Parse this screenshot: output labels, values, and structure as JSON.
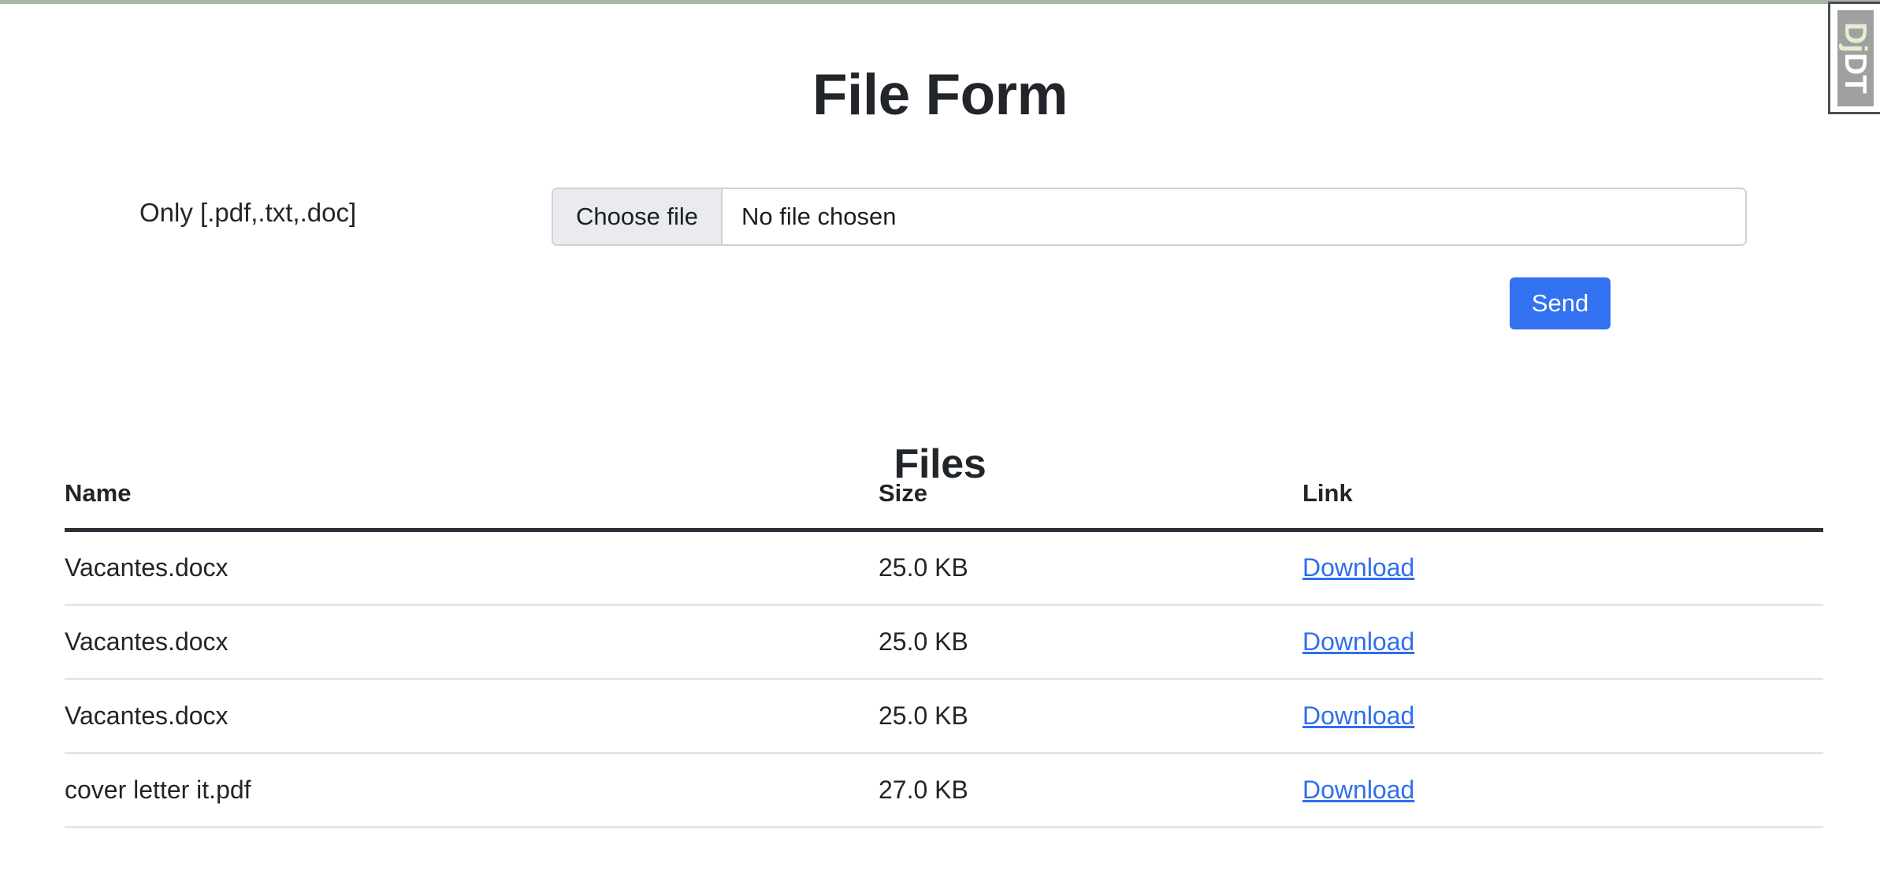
{
  "page": {
    "title": "File Form",
    "accent_top_border_color": "#a8b4a4"
  },
  "debug_toolbar": {
    "label_prefix": "Dj",
    "label_suffix": "DT",
    "prefix_color": "#e2f0d0",
    "suffix_color": "#ffffff",
    "background_color": "#a0a0a0"
  },
  "form": {
    "label": "Only [.pdf,.txt,.doc]",
    "file_input": {
      "button_label": "Choose file",
      "value": "No file chosen",
      "placeholder": "No file chosen"
    },
    "submit": {
      "label": "Send",
      "color": "#3272f0"
    }
  },
  "files_section": {
    "heading": "Files",
    "columns": [
      "Name",
      "Size",
      "Link"
    ],
    "link_label": "Download",
    "link_color": "#2f6fed",
    "rows": [
      {
        "name": "Vacantes.docx",
        "size": "25.0 KB",
        "link": "Download"
      },
      {
        "name": "Vacantes.docx",
        "size": "25.0 KB",
        "link": "Download"
      },
      {
        "name": "Vacantes.docx",
        "size": "25.0 KB",
        "link": "Download"
      },
      {
        "name": "cover letter it.pdf",
        "size": "27.0 KB",
        "link": "Download"
      }
    ]
  }
}
